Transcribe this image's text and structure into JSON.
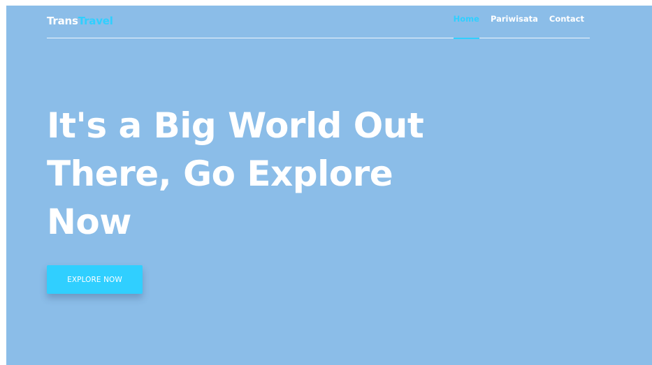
{
  "colors": {
    "background": "#8bbde8",
    "accent": "#30cfff",
    "text": "#ffffff"
  },
  "brand": {
    "part1": "Trans",
    "part2": "Travel"
  },
  "nav": {
    "items": [
      {
        "label": "Home",
        "active": true
      },
      {
        "label": "Pariwisata",
        "active": false
      },
      {
        "label": "Contact",
        "active": false
      }
    ]
  },
  "hero": {
    "title": "It's a Big World Out There, Go Explore Now",
    "cta_label": "EXPLORE NOW"
  }
}
